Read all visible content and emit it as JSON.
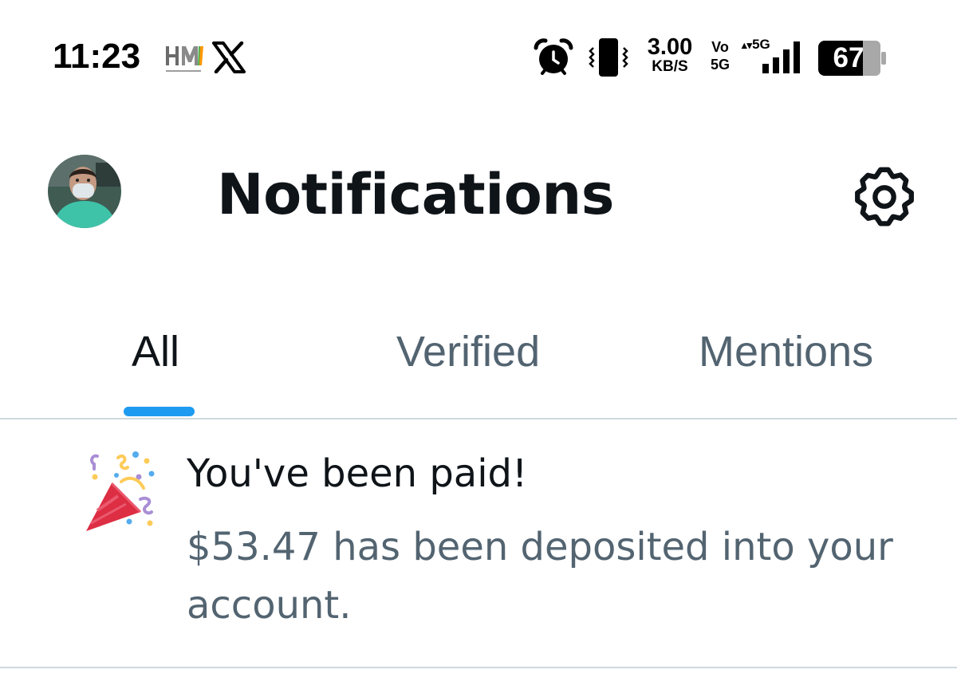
{
  "status_bar": {
    "time": "11:23",
    "speed_value": "3.00",
    "speed_unit": "KB/S",
    "volte_top": "Vo",
    "volte_bottom": "5G",
    "network_type": "5G",
    "battery_level": "67",
    "icons": [
      "hm-app-icon",
      "x-logo-icon",
      "alarm-icon",
      "vibrate-icon",
      "signal-icon",
      "battery-icon"
    ]
  },
  "header": {
    "title": "Notifications",
    "icons": [
      "avatar",
      "gear-icon"
    ]
  },
  "tabs": [
    {
      "label": "All",
      "active": true
    },
    {
      "label": "Verified",
      "active": false
    },
    {
      "label": "Mentions",
      "active": false
    }
  ],
  "notifications": [
    {
      "icon": "party-popper-icon",
      "title": "You've been paid!",
      "body": "$53.47 has been deposited into your account."
    }
  ],
  "colors": {
    "accent": "#1d9bf0",
    "primary_text": "#0f1419",
    "secondary_text": "#536471",
    "divider": "#cfd9de"
  }
}
